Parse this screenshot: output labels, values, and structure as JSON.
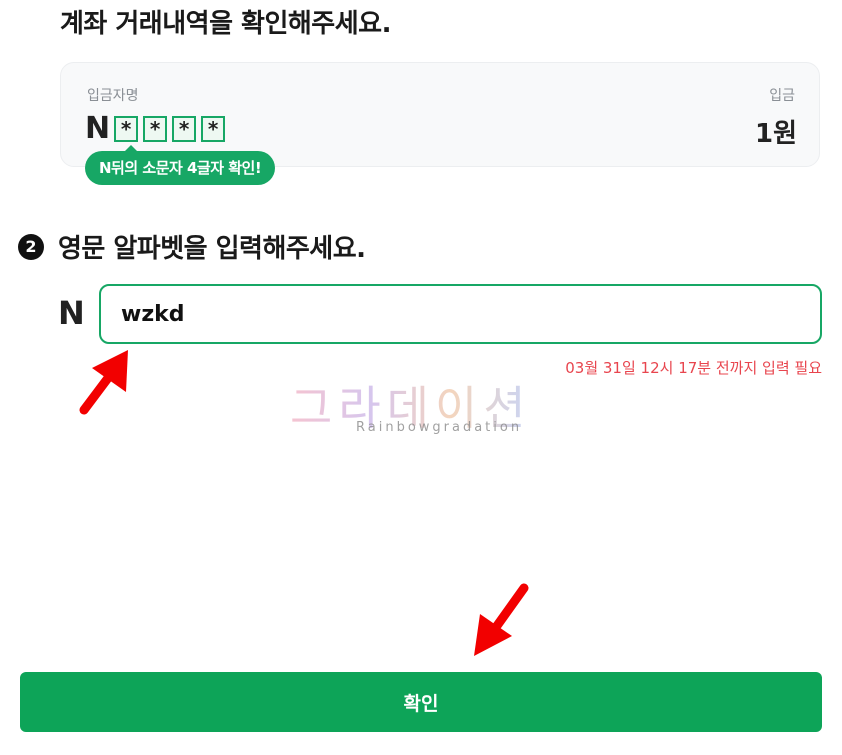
{
  "header": {
    "title": "계좌 거래내역을 확인해주세요."
  },
  "transaction_card": {
    "depositor_label": "입금자명",
    "deposit_label": "입금",
    "masked_prefix": "N",
    "masked_chars": [
      "*",
      "*",
      "*",
      "*"
    ],
    "amount": "1원",
    "hint": "N뒤의 소문자 4글자 확인!"
  },
  "step2": {
    "number": "2",
    "title": "영문 알파벳을 입력해주세요.",
    "prefix": "N",
    "input_value": "wzkd",
    "deadline": "03월 31일 12시 17분 전까지 입력 필요"
  },
  "watermark": {
    "main": "그라데이션",
    "sub": "Rainbowgradation"
  },
  "confirm_button": {
    "label": "확인"
  },
  "colors": {
    "accent": "#17a765",
    "button": "#0da458",
    "warning": "#e8454e",
    "arrow": "#f20000"
  }
}
